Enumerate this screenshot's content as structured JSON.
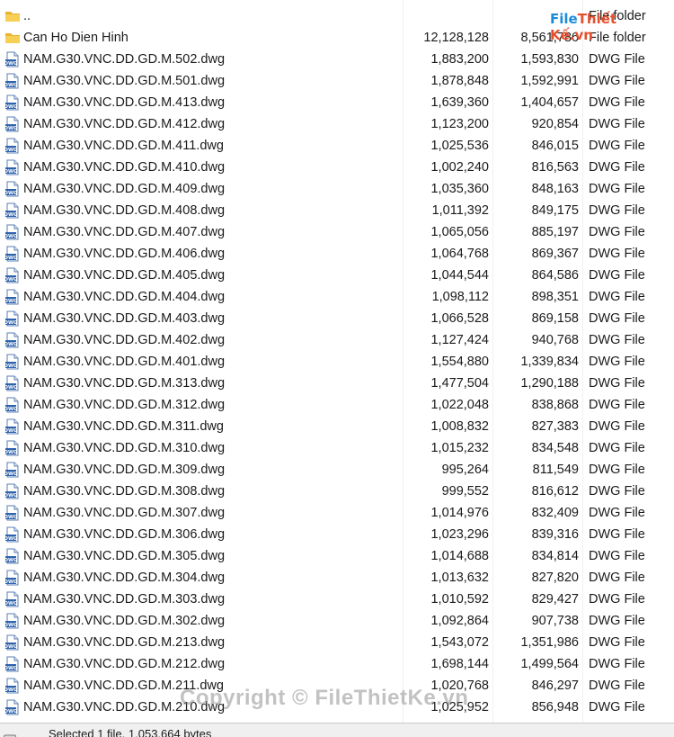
{
  "files": [
    {
      "name": "..",
      "size": "",
      "packed": "",
      "type": "File folder",
      "icon": "folder-icon"
    },
    {
      "name": "Can Ho Dien Hinh",
      "size": "12,128,128",
      "packed": "8,561,786",
      "type": "File folder",
      "icon": "folder-icon"
    },
    {
      "name": "NAM.G30.VNC.DD.GD.M.502.dwg",
      "size": "1,883,200",
      "packed": "1,593,830",
      "type": "DWG File",
      "icon": "dwg-file-icon"
    },
    {
      "name": "NAM.G30.VNC.DD.GD.M.501.dwg",
      "size": "1,878,848",
      "packed": "1,592,991",
      "type": "DWG File",
      "icon": "dwg-file-icon"
    },
    {
      "name": "NAM.G30.VNC.DD.GD.M.413.dwg",
      "size": "1,639,360",
      "packed": "1,404,657",
      "type": "DWG File",
      "icon": "dwg-file-icon"
    },
    {
      "name": "NAM.G30.VNC.DD.GD.M.412.dwg",
      "size": "1,123,200",
      "packed": "920,854",
      "type": "DWG File",
      "icon": "dwg-file-icon"
    },
    {
      "name": "NAM.G30.VNC.DD.GD.M.411.dwg",
      "size": "1,025,536",
      "packed": "846,015",
      "type": "DWG File",
      "icon": "dwg-file-icon"
    },
    {
      "name": "NAM.G30.VNC.DD.GD.M.410.dwg",
      "size": "1,002,240",
      "packed": "816,563",
      "type": "DWG File",
      "icon": "dwg-file-icon"
    },
    {
      "name": "NAM.G30.VNC.DD.GD.M.409.dwg",
      "size": "1,035,360",
      "packed": "848,163",
      "type": "DWG File",
      "icon": "dwg-file-icon"
    },
    {
      "name": "NAM.G30.VNC.DD.GD.M.408.dwg",
      "size": "1,011,392",
      "packed": "849,175",
      "type": "DWG File",
      "icon": "dwg-file-icon"
    },
    {
      "name": "NAM.G30.VNC.DD.GD.M.407.dwg",
      "size": "1,065,056",
      "packed": "885,197",
      "type": "DWG File",
      "icon": "dwg-file-icon"
    },
    {
      "name": "NAM.G30.VNC.DD.GD.M.406.dwg",
      "size": "1,064,768",
      "packed": "869,367",
      "type": "DWG File",
      "icon": "dwg-file-icon"
    },
    {
      "name": "NAM.G30.VNC.DD.GD.M.405.dwg",
      "size": "1,044,544",
      "packed": "864,586",
      "type": "DWG File",
      "icon": "dwg-file-icon"
    },
    {
      "name": "NAM.G30.VNC.DD.GD.M.404.dwg",
      "size": "1,098,112",
      "packed": "898,351",
      "type": "DWG File",
      "icon": "dwg-file-icon"
    },
    {
      "name": "NAM.G30.VNC.DD.GD.M.403.dwg",
      "size": "1,066,528",
      "packed": "869,158",
      "type": "DWG File",
      "icon": "dwg-file-icon"
    },
    {
      "name": "NAM.G30.VNC.DD.GD.M.402.dwg",
      "size": "1,127,424",
      "packed": "940,768",
      "type": "DWG File",
      "icon": "dwg-file-icon"
    },
    {
      "name": "NAM.G30.VNC.DD.GD.M.401.dwg",
      "size": "1,554,880",
      "packed": "1,339,834",
      "type": "DWG File",
      "icon": "dwg-file-icon"
    },
    {
      "name": "NAM.G30.VNC.DD.GD.M.313.dwg",
      "size": "1,477,504",
      "packed": "1,290,188",
      "type": "DWG File",
      "icon": "dwg-file-icon"
    },
    {
      "name": "NAM.G30.VNC.DD.GD.M.312.dwg",
      "size": "1,022,048",
      "packed": "838,868",
      "type": "DWG File",
      "icon": "dwg-file-icon"
    },
    {
      "name": "NAM.G30.VNC.DD.GD.M.311.dwg",
      "size": "1,008,832",
      "packed": "827,383",
      "type": "DWG File",
      "icon": "dwg-file-icon"
    },
    {
      "name": "NAM.G30.VNC.DD.GD.M.310.dwg",
      "size": "1,015,232",
      "packed": "834,548",
      "type": "DWG File",
      "icon": "dwg-file-icon"
    },
    {
      "name": "NAM.G30.VNC.DD.GD.M.309.dwg",
      "size": "995,264",
      "packed": "811,549",
      "type": "DWG File",
      "icon": "dwg-file-icon"
    },
    {
      "name": "NAM.G30.VNC.DD.GD.M.308.dwg",
      "size": "999,552",
      "packed": "816,612",
      "type": "DWG File",
      "icon": "dwg-file-icon"
    },
    {
      "name": "NAM.G30.VNC.DD.GD.M.307.dwg",
      "size": "1,014,976",
      "packed": "832,409",
      "type": "DWG File",
      "icon": "dwg-file-icon"
    },
    {
      "name": "NAM.G30.VNC.DD.GD.M.306.dwg",
      "size": "1,023,296",
      "packed": "839,316",
      "type": "DWG File",
      "icon": "dwg-file-icon"
    },
    {
      "name": "NAM.G30.VNC.DD.GD.M.305.dwg",
      "size": "1,014,688",
      "packed": "834,814",
      "type": "DWG File",
      "icon": "dwg-file-icon"
    },
    {
      "name": "NAM.G30.VNC.DD.GD.M.304.dwg",
      "size": "1,013,632",
      "packed": "827,820",
      "type": "DWG File",
      "icon": "dwg-file-icon"
    },
    {
      "name": "NAM.G30.VNC.DD.GD.M.303.dwg",
      "size": "1,010,592",
      "packed": "829,427",
      "type": "DWG File",
      "icon": "dwg-file-icon"
    },
    {
      "name": "NAM.G30.VNC.DD.GD.M.302.dwg",
      "size": "1,092,864",
      "packed": "907,738",
      "type": "DWG File",
      "icon": "dwg-file-icon"
    },
    {
      "name": "NAM.G30.VNC.DD.GD.M.213.dwg",
      "size": "1,543,072",
      "packed": "1,351,986",
      "type": "DWG File",
      "icon": "dwg-file-icon"
    },
    {
      "name": "NAM.G30.VNC.DD.GD.M.212.dwg",
      "size": "1,698,144",
      "packed": "1,499,564",
      "type": "DWG File",
      "icon": "dwg-file-icon"
    },
    {
      "name": "NAM.G30.VNC.DD.GD.M.211.dwg",
      "size": "1,020,768",
      "packed": "846,297",
      "type": "DWG File",
      "icon": "dwg-file-icon"
    },
    {
      "name": "NAM.G30.VNC.DD.GD.M.210.dwg",
      "size": "1,025,952",
      "packed": "856,948",
      "type": "DWG File",
      "icon": "dwg-file-icon"
    }
  ],
  "status": {
    "text": "Selected 1 file, 1,053,664 bytes",
    "icon": "drive-icon"
  },
  "watermarks": {
    "top_file": "File",
    "top_rest": "Thiết Kế.vn",
    "bottom": "Copyright © FileThietKe.vn"
  },
  "colors": {
    "folder": "#f4c542",
    "dwg_icon_blue": "#3b6fb6",
    "column_bg": "#ffffff",
    "statusbar_bg": "#f0f0f0"
  }
}
